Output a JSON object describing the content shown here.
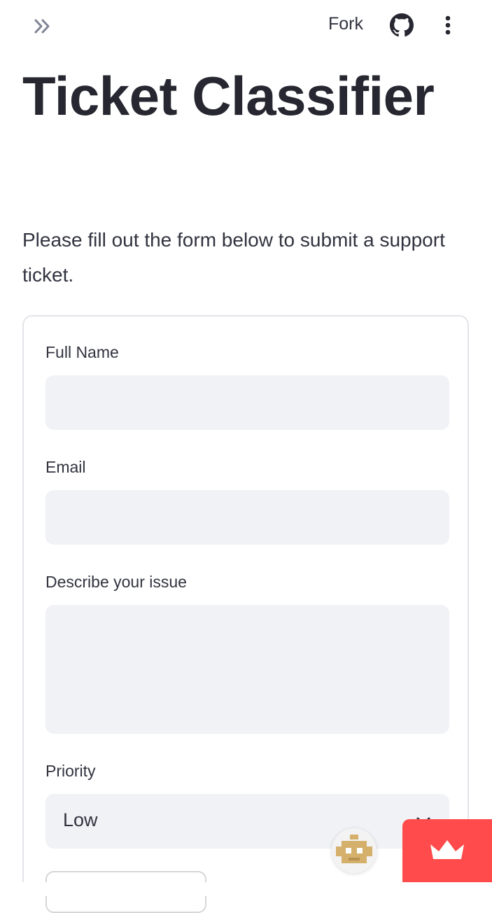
{
  "header": {
    "fork_label": "Fork",
    "icons": [
      "expand-sidebar-icon",
      "github-icon",
      "kebab-menu-icon"
    ]
  },
  "page": {
    "title": "Ticket Classifier",
    "intro": "Please fill out the form below to submit a support ticket."
  },
  "form": {
    "fields": [
      {
        "label": "Full Name",
        "value": ""
      },
      {
        "label": "Email",
        "value": ""
      },
      {
        "label": "Describe your issue",
        "value": ""
      }
    ],
    "priority": {
      "label": "Priority",
      "selected": "Low"
    }
  },
  "colors": {
    "input_bg": "#f0f2f6",
    "text": "#31333f",
    "accent": "#ff4b4b"
  }
}
